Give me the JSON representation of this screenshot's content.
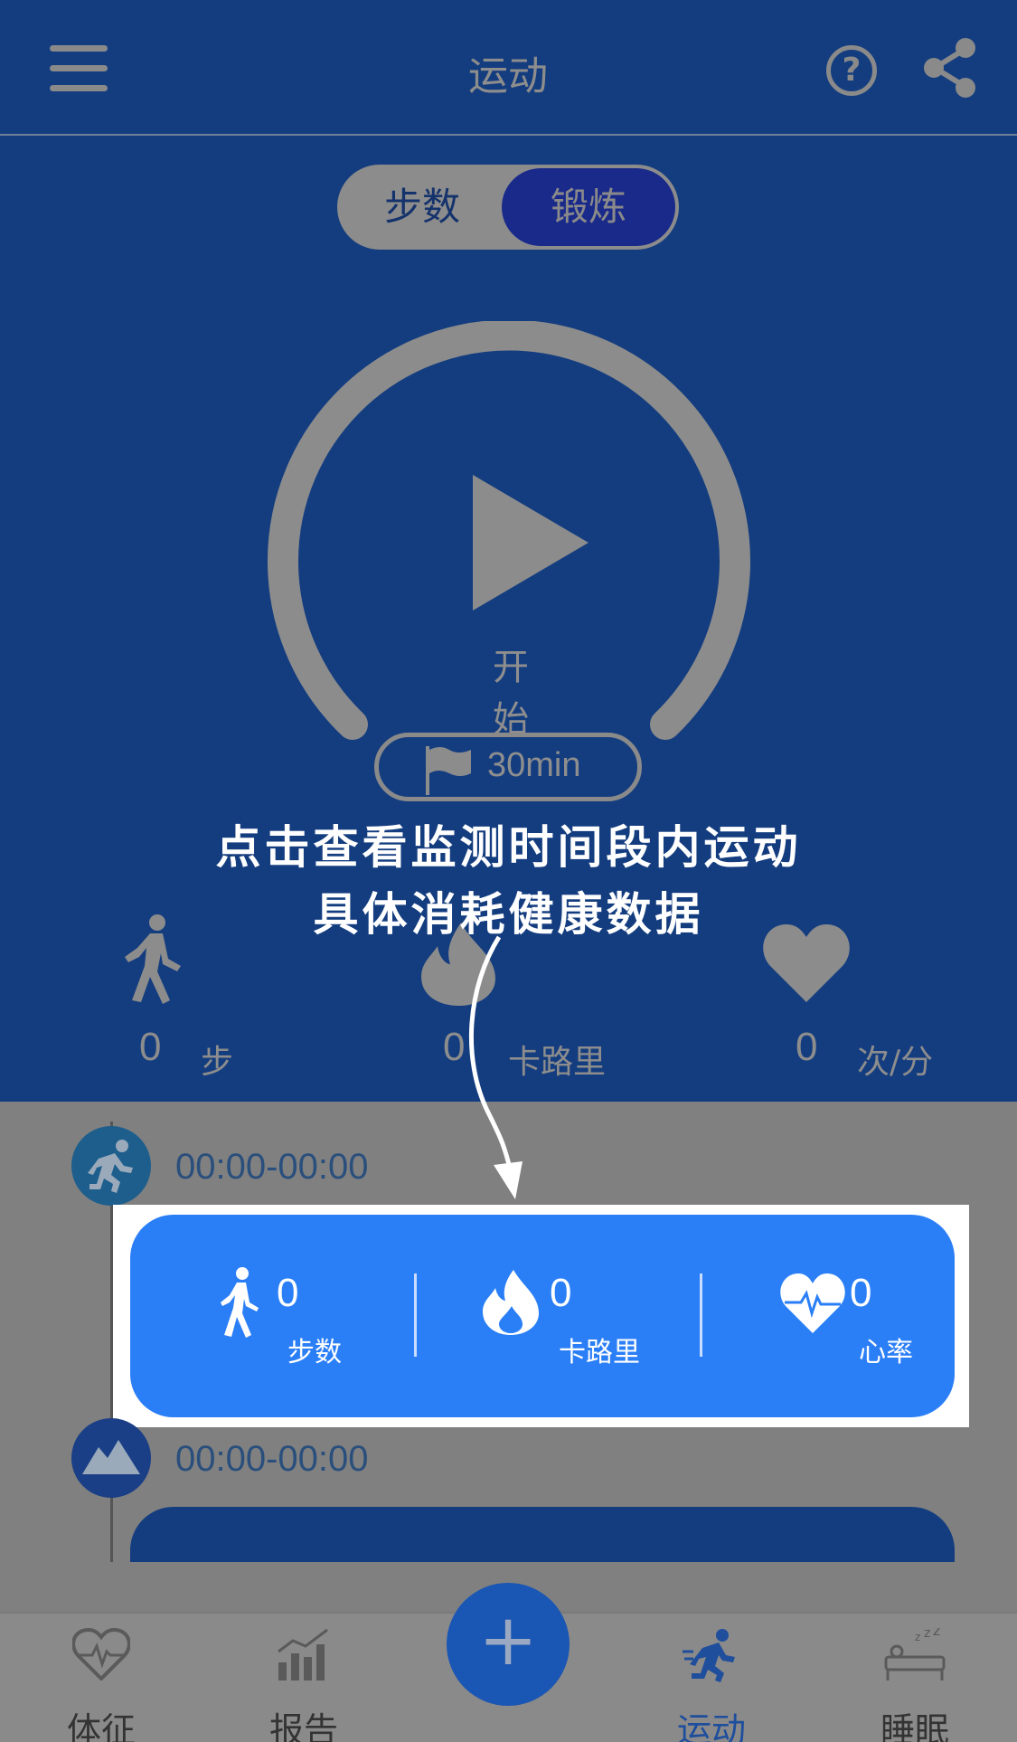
{
  "header": {
    "title": "运动",
    "menu_icon": "menu-icon",
    "help_glyph": "?",
    "share_icon": "share-icon"
  },
  "segment": {
    "left": "步数",
    "right": "锻炼",
    "selected": "锻炼"
  },
  "start": {
    "label": "开 始",
    "goal": "30min"
  },
  "stats": [
    {
      "icon": "walking-icon",
      "value": "0",
      "unit": "步"
    },
    {
      "icon": "flame-icon",
      "value": "0",
      "unit": "卡路里"
    },
    {
      "icon": "heart-icon",
      "value": "0",
      "unit": "次/分"
    }
  ],
  "hint": {
    "line1": "点击查看监测时间段内运动",
    "line2": "具体消耗健康数据"
  },
  "timeline": [
    {
      "icon": "running-icon",
      "time": "00:00-00:00"
    },
    {
      "icon": "mountain-icon",
      "time": "00:00-00:00"
    }
  ],
  "card": [
    {
      "icon": "walking-icon",
      "value": "0",
      "label": "步数"
    },
    {
      "icon": "flame-icon",
      "value": "0",
      "label": "卡路里"
    },
    {
      "icon": "heart-rate-icon",
      "value": "0",
      "label": "心率"
    }
  ],
  "nav": [
    {
      "icon": "vitals-icon",
      "label": "体征"
    },
    {
      "icon": "report-icon",
      "label": "报告"
    },
    {
      "icon": "plus-icon",
      "label": "+"
    },
    {
      "icon": "exercise-icon",
      "label": "运动"
    },
    {
      "icon": "sleep-icon",
      "label": "睡眠"
    }
  ],
  "colors": {
    "card_blue": "#2b7ff6",
    "header_blue": "#143d7f",
    "dim_gray": "#808080"
  }
}
